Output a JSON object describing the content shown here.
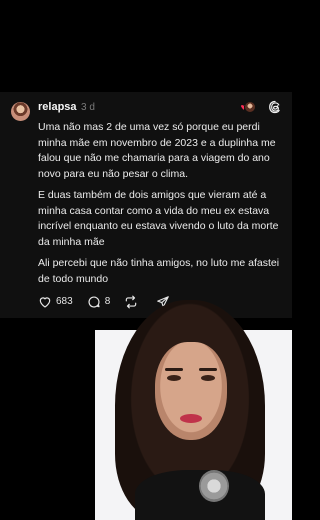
{
  "post": {
    "username": "relapsa",
    "time": "3 d",
    "paragraphs": [
      "Uma não mas 2 de uma vez só porque eu perdi minha mãe em novembro de 2023 e a duplinha me falou que não me chamaria para a viagem do ano novo para eu não pesar o clima.",
      "E duas também de dois amigos que vieram até a minha casa contar como a vida do meu ex estava incrível enquanto eu estava vivendo o luto da morte da minha mãe",
      "Ali percebi que não tinha amigos, no luto me afastei de todo mundo"
    ],
    "likes": "683",
    "replies": "8"
  },
  "icons": {
    "logo": "threads-icon",
    "like": "heart-icon",
    "reply": "comment-icon",
    "repost": "repost-icon",
    "share": "send-icon"
  },
  "colors": {
    "background": "#000000",
    "card": "#101010",
    "heart_badge": "#ff2d55"
  }
}
